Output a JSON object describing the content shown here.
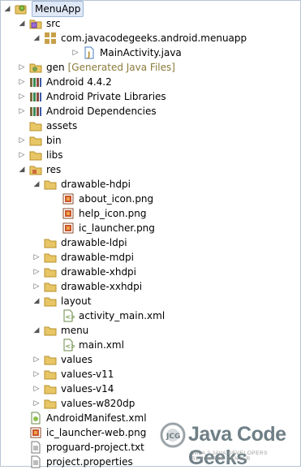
{
  "tree": {
    "root": "MenuApp",
    "src": "src",
    "package": "com.javacodegeeks.android.menuapp",
    "main_activity": "MainActivity.java",
    "gen": "gen",
    "gen_decor": "[Generated Java Files]",
    "android_version": "Android 4.4.2",
    "android_private_libs": "Android Private Libraries",
    "android_deps": "Android Dependencies",
    "assets": "assets",
    "bin": "bin",
    "libs": "libs",
    "res": "res",
    "drawable_hdpi": "drawable-hdpi",
    "about_icon": "about_icon.png",
    "help_icon": "help_icon.png",
    "ic_launcher": "ic_launcher.png",
    "drawable_ldpi": "drawable-ldpi",
    "drawable_mdpi": "drawable-mdpi",
    "drawable_xhdpi": "drawable-xhdpi",
    "drawable_xxhdpi": "drawable-xxhdpi",
    "layout": "layout",
    "activity_main": "activity_main.xml",
    "menu": "menu",
    "main_xml": "main.xml",
    "values": "values",
    "values_v11": "values-v11",
    "values_v14": "values-v14",
    "values_w820dp": "values-w820dp",
    "android_manifest": "AndroidManifest.xml",
    "ic_launcher_web": "ic_launcher-web.png",
    "proguard": "proguard-project.txt",
    "project_props": "project.properties"
  },
  "logo": {
    "brand": "Java Code Geeks",
    "tagline": "JAVA 2 JAVA DEVELOPERS RESOURCE CENTER"
  },
  "colors": {
    "folder": "#e8c666",
    "folder_dark": "#b8902a",
    "java": "#4a7fc1",
    "library": "#7b6a3c"
  }
}
